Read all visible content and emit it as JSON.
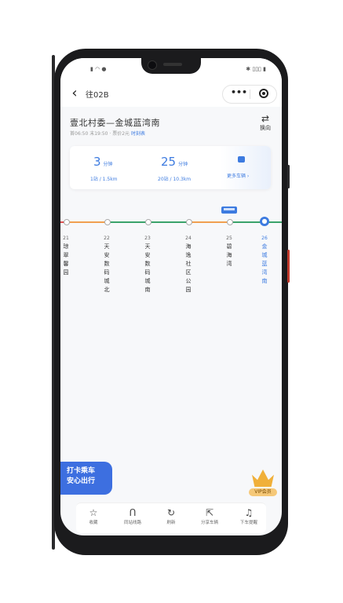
{
  "status": {
    "left": "▮ ◠ ●",
    "right": "✱ ▯▯▯ ▮"
  },
  "nav": {
    "back_glyph": "‹",
    "title": "往02B",
    "more_glyph": "•••"
  },
  "route": {
    "title": "壹北村委—金城蓝湾南",
    "sub": "首06:50  末19:50  · 票价2元",
    "timetable": "时刻表"
  },
  "switch": {
    "label": "换向",
    "glyph": "⇄"
  },
  "arrival": [
    {
      "time": "3",
      "unit": "分钟",
      "detail": "1站 / 1.5km"
    },
    {
      "time": "25",
      "unit": "分钟",
      "detail": "20站 / 10.3km"
    }
  ],
  "more_buses": "更多车辆 ›",
  "stops": [
    {
      "no": "21",
      "name": "琼翠馨园"
    },
    {
      "no": "22",
      "name": "天安数码城北"
    },
    {
      "no": "23",
      "name": "天安数码城南"
    },
    {
      "no": "24",
      "name": "海逸社区公园"
    },
    {
      "no": "25",
      "name": "碧海湾"
    },
    {
      "no": "26",
      "name": "金城蓝湾南",
      "current": true
    }
  ],
  "promo": {
    "line1": "打卡乘车",
    "line2": "安心出行"
  },
  "vip": {
    "label": "VIP会员"
  },
  "tabs": [
    {
      "icon": "star-icon",
      "glyph": "☆",
      "label": "收藏"
    },
    {
      "icon": "route-icon",
      "glyph": "ᑎ",
      "label": "同站线路"
    },
    {
      "icon": "refresh-icon",
      "glyph": "↻",
      "label": "刷新"
    },
    {
      "icon": "share-icon",
      "glyph": "⇱",
      "label": "分享车辆"
    },
    {
      "icon": "bell-icon",
      "glyph": "♫",
      "label": "下车提醒"
    }
  ],
  "colors": {
    "accent": "#3d7be0",
    "line_orange": "#f0a050",
    "line_green": "#3aa36a",
    "line_red": "#e05050"
  }
}
